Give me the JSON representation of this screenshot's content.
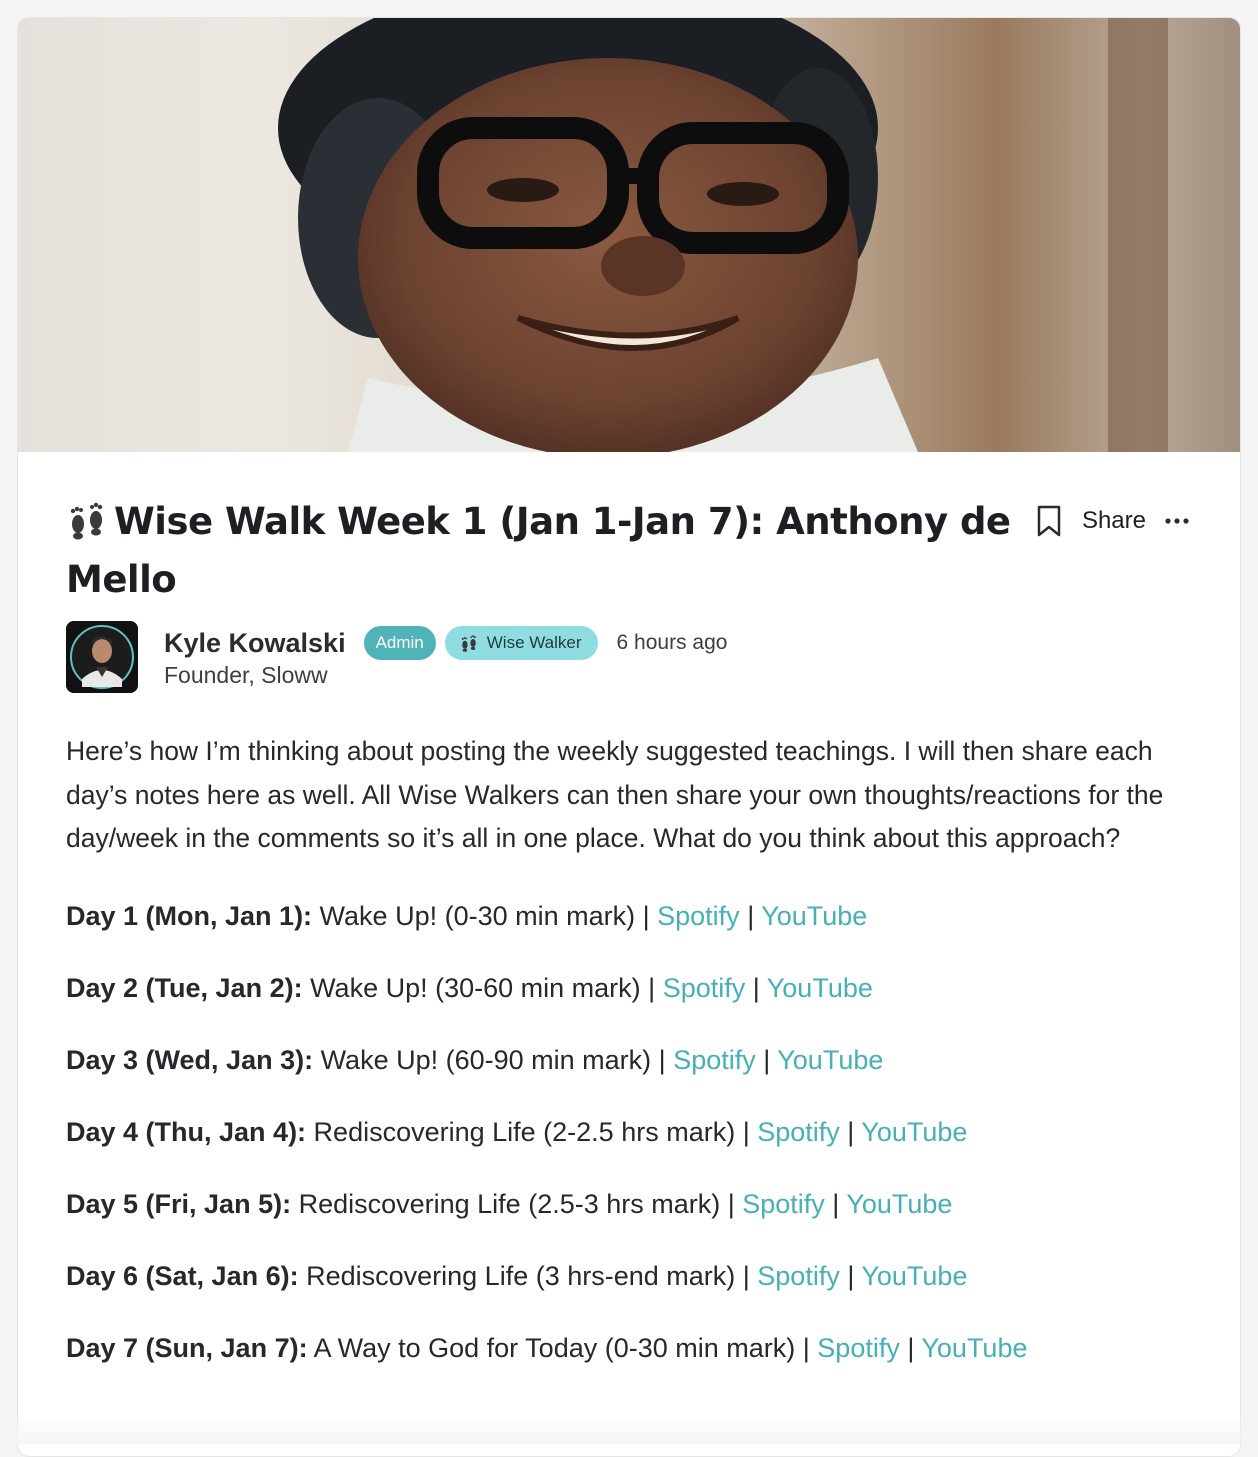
{
  "post": {
    "cover_alt": "",
    "title": "Wise Walk Week 1 (Jan 1-Jan 7): Anthony de Mello",
    "title_emoji": "footprints-emoji",
    "actions": {
      "bookmark_icon": "bookmark-icon",
      "share_label": "Share",
      "more_icon": "ellipsis-icon"
    },
    "author": {
      "name": "Kyle Kowalski",
      "role": "Founder, Sloww",
      "badges": [
        "Admin",
        "Wise Walker"
      ],
      "timestamp": "6 hours ago"
    },
    "body": "Here’s how I’m thinking about posting the weekly suggested teachings. I will then share each day’s notes here as well. All Wise Walkers can then share your own thoughts/reactions for the day/week in the comments so it’s all in one place. What do you think about this approach?",
    "days": [
      {
        "label": "Day 1 (Mon, Jan 1):",
        "text": " Wake Up! (0-30 min mark) | ",
        "spotify": "Spotify",
        "youtube": "YouTube"
      },
      {
        "label": "Day 2 (Tue, Jan 2):",
        "text": " Wake Up! (30-60 min mark) | ",
        "spotify": "Spotify",
        "youtube": "YouTube"
      },
      {
        "label": "Day 3 (Wed, Jan 3):",
        "text": " Wake Up! (60-90 min mark) | ",
        "spotify": "Spotify",
        "youtube": "YouTube"
      },
      {
        "label": "Day 4 (Thu, Jan 4):",
        "text": " Rediscovering Life (2-2.5 hrs mark) | ",
        "spotify": "Spotify",
        "youtube": "YouTube"
      },
      {
        "label": "Day 5 (Fri, Jan 5):",
        "text": " Rediscovering Life (2.5-3 hrs mark) | ",
        "spotify": "Spotify",
        "youtube": "YouTube"
      },
      {
        "label": "Day 6 (Sat, Jan 6):",
        "text": " Rediscovering Life (3 hrs-end mark) | ",
        "spotify": "Spotify",
        "youtube": "YouTube"
      },
      {
        "label": "Day 7 (Sun, Jan 7):",
        "text": " A Way to God for Today (0-30 min mark) | ",
        "spotify": "Spotify",
        "youtube": "YouTube"
      }
    ],
    "separator": " | "
  },
  "colors": {
    "accent_link": "#47b0b5",
    "admin_badge": "#4fb3b8",
    "walker_badge": "#8fdde0"
  }
}
